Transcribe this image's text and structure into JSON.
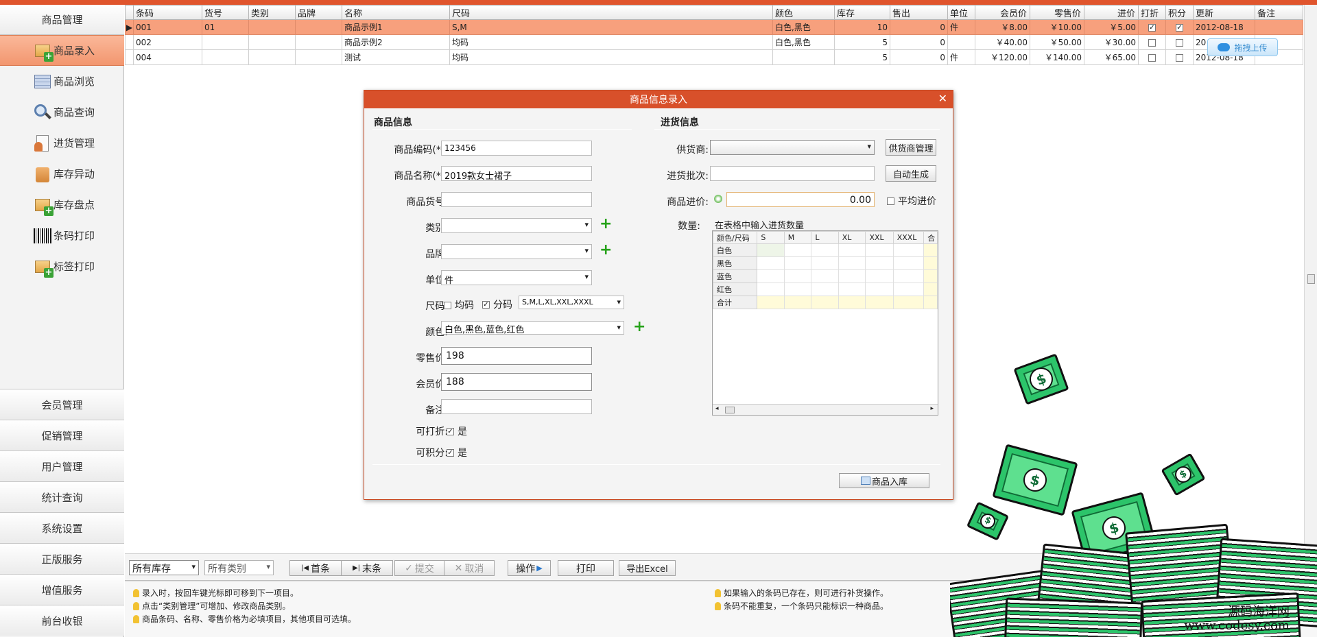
{
  "sidebar": {
    "header": "商品管理",
    "items": [
      {
        "label": "商品录入",
        "icon": "product-add-icon",
        "active": true
      },
      {
        "label": "商品浏览",
        "icon": "product-list-icon",
        "active": false
      },
      {
        "label": "商品查询",
        "icon": "magnifier-icon",
        "active": false
      },
      {
        "label": "进货管理",
        "icon": "purchase-doc-icon",
        "active": false
      },
      {
        "label": "库存异动",
        "icon": "stock-change-icon",
        "active": false
      },
      {
        "label": "库存盘点",
        "icon": "stock-check-icon",
        "active": false
      },
      {
        "label": "条码打印",
        "icon": "barcode-icon",
        "active": false
      },
      {
        "label": "标签打印",
        "icon": "label-print-icon",
        "active": false
      }
    ],
    "bottom": [
      "会员管理",
      "促销管理",
      "用户管理",
      "统计查询",
      "系统设置",
      "正版服务",
      "增值服务",
      "前台收银"
    ]
  },
  "table": {
    "columns": [
      "条码",
      "货号",
      "类别",
      "品牌",
      "名称",
      "尺码",
      "颜色",
      "库存",
      "售出",
      "单位",
      "会员价",
      "零售价",
      "进价",
      "打折",
      "积分",
      "更新",
      "备注"
    ],
    "rows": [
      {
        "barcode": "001",
        "sku": "01",
        "category": "",
        "brand": "",
        "name": "商品示例1",
        "size": "S,M",
        "color": "白色,黑色",
        "stock": "10",
        "sold": "0",
        "unit": "件",
        "member_price": "￥8.00",
        "retail_price": "￥10.00",
        "cost": "￥5.00",
        "discount": true,
        "points": true,
        "updated": "2012-08-18",
        "note": "",
        "selected": true
      },
      {
        "barcode": "002",
        "sku": "",
        "category": "",
        "brand": "",
        "name": "商品示例2",
        "size": "均码",
        "color": "白色,黑色",
        "stock": "5",
        "sold": "0",
        "unit": "",
        "member_price": "￥40.00",
        "retail_price": "￥50.00",
        "cost": "￥30.00",
        "discount": false,
        "points": false,
        "updated": "20",
        "note": "",
        "selected": false
      },
      {
        "barcode": "004",
        "sku": "",
        "category": "",
        "brand": "",
        "name": "测试",
        "size": "均码",
        "color": "",
        "stock": "5",
        "sold": "0",
        "unit": "件",
        "member_price": "￥120.00",
        "retail_price": "￥140.00",
        "cost": "￥65.00",
        "discount": false,
        "points": false,
        "updated": "2012-08-18",
        "note": "",
        "selected": false
      }
    ]
  },
  "upload_button": "拖拽上传",
  "dialog": {
    "title": "商品信息录入",
    "close": "✕",
    "product_section": "商品信息",
    "purchase_section": "进货信息",
    "fields": {
      "code_label": "商品编码(*):",
      "code_value": "123456",
      "name_label": "商品名称(*):",
      "name_value": "2019款女士裙子",
      "sku_label": "商品货号:",
      "sku_value": "",
      "category_label": "类别:",
      "category_value": "",
      "brand_label": "品牌:",
      "brand_value": "",
      "unit_label": "单位:",
      "unit_value": "件",
      "size_label": "尺码:",
      "size_uniform_label": "均码",
      "size_uniform_checked": false,
      "size_split_label": "分码",
      "size_split_checked": true,
      "size_value": "S,M,L,XL,XXL,XXXL",
      "color_label": "颜色:",
      "color_value": "白色,黑色,蓝色,红色",
      "retail_label": "零售价:",
      "retail_value": "198",
      "member_label": "会员价:",
      "member_value": "188",
      "note_label": "备注:",
      "note_value": "",
      "discount_label": "可打折:",
      "discount_text": "是",
      "discount_checked": true,
      "points_label": "可积分:",
      "points_text": "是",
      "points_checked": true
    },
    "purchase": {
      "supplier_label": "供货商:",
      "supplier_value": "",
      "supplier_button": "供货商管理",
      "batch_label": "进货批次:",
      "batch_value": "",
      "batch_button": "自动生成",
      "cost_label": "商品进价:",
      "cost_value": "0.00",
      "avg_cost_label": "平均进价",
      "avg_cost_checked": false,
      "qty_label": "数量:",
      "qty_hint": "在表格中输入进货数量",
      "grid_corner": "颜色/尺码",
      "grid_sizes": [
        "S",
        "M",
        "L",
        "XL",
        "XXL",
        "XXXL",
        "合"
      ],
      "grid_rows": [
        "白色",
        "黑色",
        "蓝色",
        "红色",
        "合计"
      ]
    },
    "submit": "商品入库"
  },
  "toolbar": {
    "stock_filter": "所有库存",
    "category_filter": "所有类别",
    "first": "首条",
    "last": "末条",
    "commit": "提交",
    "cancel": "取消",
    "operate": "操作",
    "print": "打印",
    "export": "导出Excel"
  },
  "tips": {
    "left": [
      "录入时，按回车键光标即可移到下一项目。",
      "点击“类别管理”可增加、修改商品类别。",
      "商品条码、名称、零售价格为必填项目，其他项目可选填。"
    ],
    "right": [
      "如果输入的条码已存在，则可进行补货操作。",
      "条码不能重复，一个条码只能标识一种商品。"
    ]
  },
  "watermark": {
    "line1": "源码海洋网",
    "line2": "www.codesy.com"
  },
  "colors": {
    "accent": "#d8502a",
    "selected_row": "#f7a07d",
    "plus_green": "#26a21a"
  }
}
